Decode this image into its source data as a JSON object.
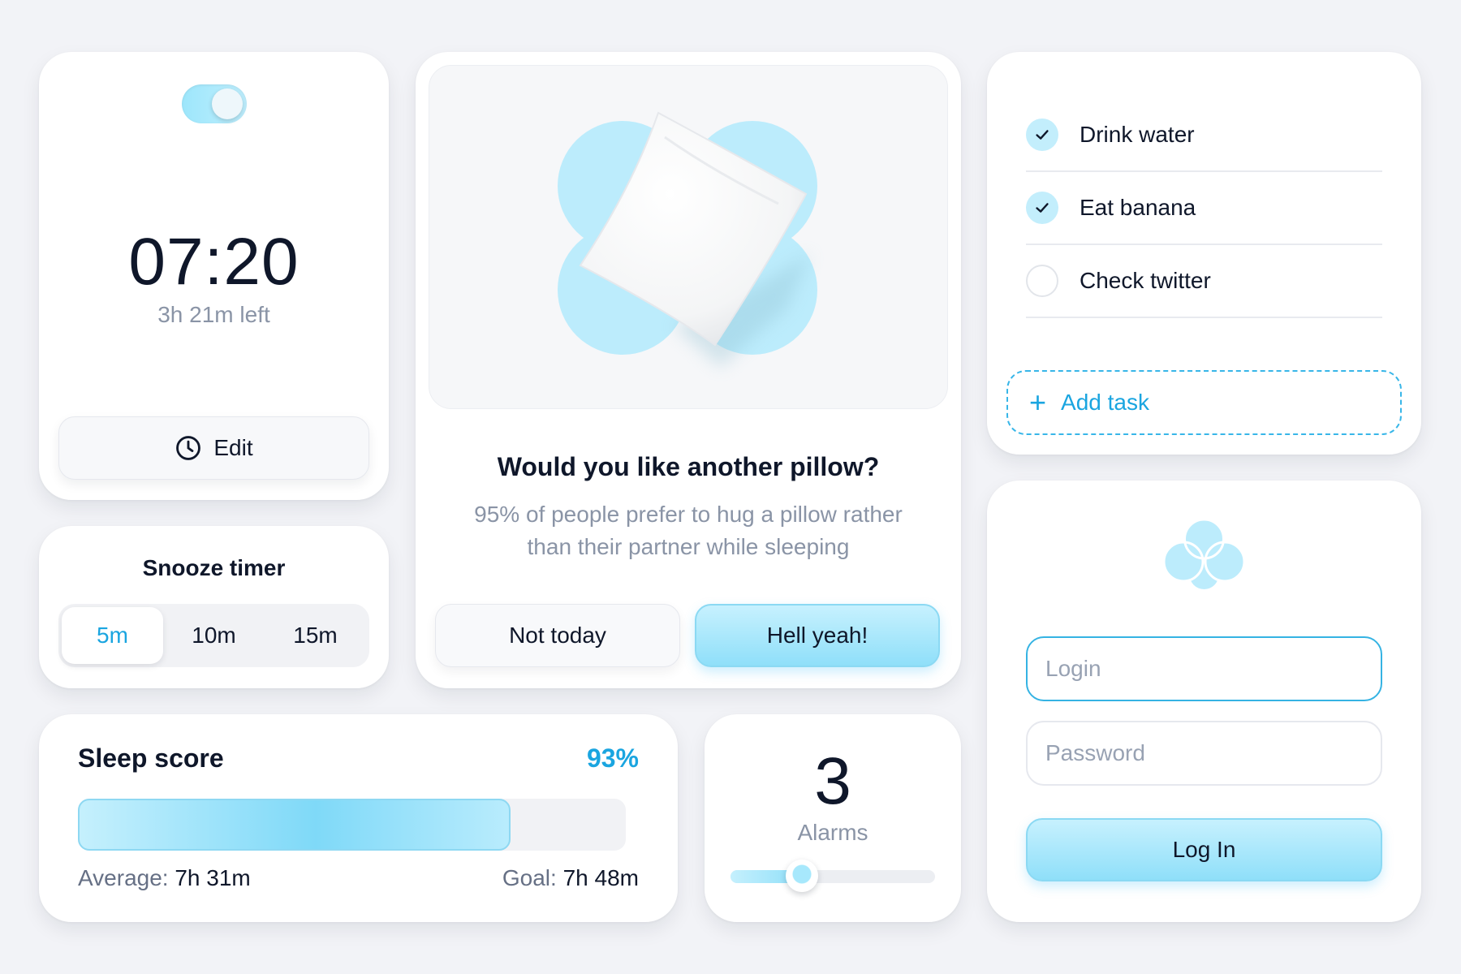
{
  "alarm": {
    "enabled": true,
    "time": "07:20",
    "left": "3h 21m left",
    "edit_label": "Edit"
  },
  "snooze": {
    "title": "Snooze timer",
    "options": [
      "5m",
      "10m",
      "15m"
    ],
    "selected": "5m"
  },
  "pillow": {
    "title": "Would you like another pillow?",
    "description": "95% of people prefer to hug a pillow rather than their partner while sleeping",
    "decline_label": "Not today",
    "accept_label": "Hell yeah!"
  },
  "tasks": {
    "items": [
      {
        "label": "Drink water",
        "done": true
      },
      {
        "label": "Eat banana",
        "done": true
      },
      {
        "label": "Check twitter",
        "done": false
      }
    ],
    "add_label": "Add task"
  },
  "login": {
    "login_placeholder": "Login",
    "password_placeholder": "Password",
    "button_label": "Log In"
  },
  "sleep": {
    "title": "Sleep score",
    "percent_label": "93%",
    "progress_fraction": 0.79,
    "average_label": "Average:",
    "average_value": "7h 31m",
    "goal_label": "Goal:",
    "goal_value": "7h 48m"
  },
  "alarms": {
    "count": "3",
    "label": "Alarms",
    "slider_fraction": 0.35
  },
  "colors": {
    "accent": "#1aa5e0",
    "accent_light": "#bfeffe",
    "background": "#f2f3f7",
    "text": "#0f172a",
    "muted": "#8a94a6"
  }
}
